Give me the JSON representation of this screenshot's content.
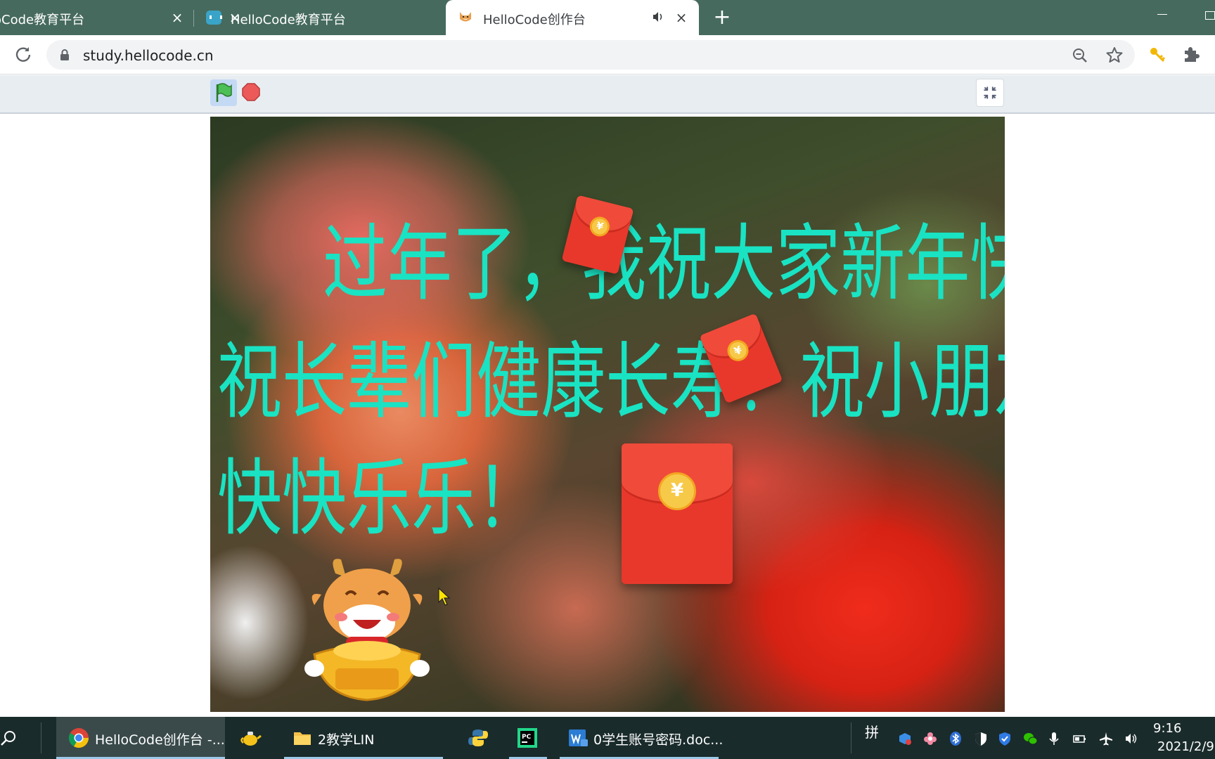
{
  "browser": {
    "tabs": [
      {
        "title": "loCode教育平台",
        "close": "×"
      },
      {
        "title": "HelloCode教育平台",
        "close": "×"
      },
      {
        "title": "HelloCode创作台",
        "close": "×",
        "active": true
      }
    ],
    "new_tab": "+",
    "address": "study.hellocode.cn"
  },
  "stage": {
    "greeting_line1": "过年了，我祝大家新年快乐！",
    "greeting_line2": "祝长辈们健康长寿！祝小朋友们",
    "greeting_line3": "快快乐乐！",
    "packet_symbol": "¥",
    "text_color": "#19e3c3"
  },
  "taskbar": {
    "apps": [
      {
        "label": "HelloCode创作台 -...",
        "icon": "chrome-icon",
        "active": true
      },
      {
        "label": "",
        "icon": "teapot-icon"
      },
      {
        "label": "2教学LIN",
        "icon": "folder-icon"
      },
      {
        "label": "",
        "icon": "python-icon"
      },
      {
        "label": "",
        "icon": "pycharm-icon"
      },
      {
        "label": "0学生账号密码.doc...",
        "icon": "word-icon"
      }
    ],
    "ime": "拼",
    "time": "9:16",
    "date": "2021/2/9"
  }
}
